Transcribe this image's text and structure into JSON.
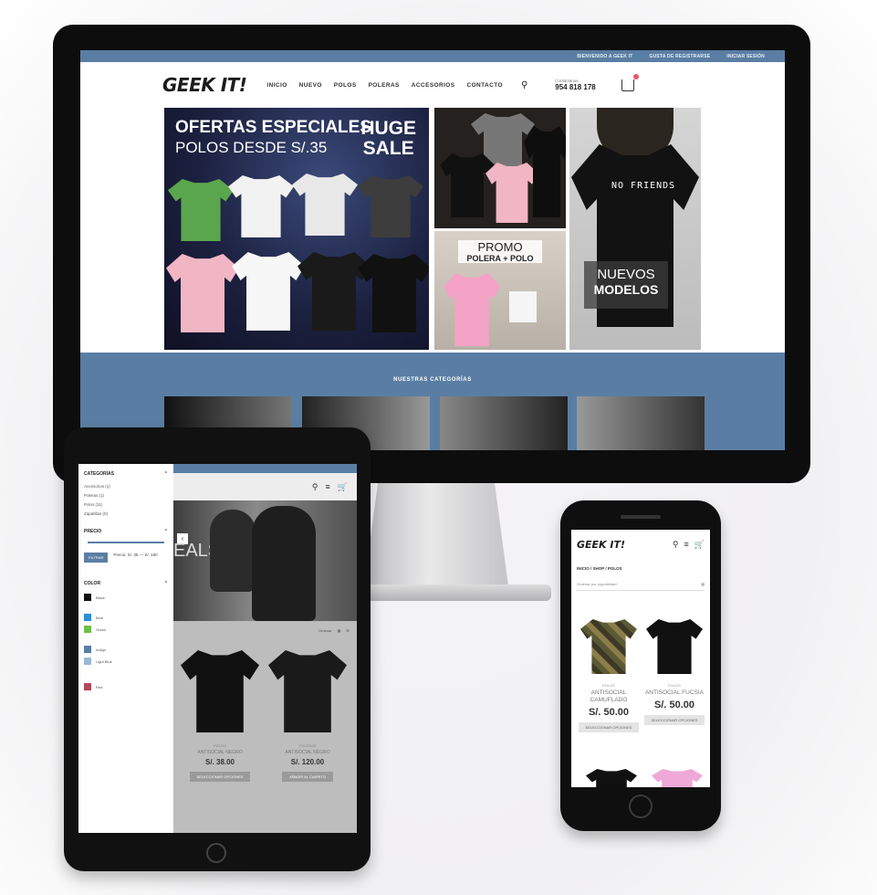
{
  "desktop": {
    "topbar_links": [
      "BIENVENIDO A GEEK IT",
      "GUSTA DE REGISTRARSE",
      "INICIAR SESIÓN"
    ],
    "logo": "GEEK IT!",
    "nav": [
      "INICIO",
      "NUEVO",
      "POLOS",
      "POLERAS",
      "ACCESORIOS",
      "CONTACTO"
    ],
    "phone_label": "Contáctanos",
    "phone_number": "954 818 178",
    "banner_main": {
      "title": "OFERTAS ESPECIALES",
      "subtitle": "POLOS DESDE S/.35",
      "sale_line1": "HUGE",
      "sale_line2": "SALE"
    },
    "banner_b": {
      "line1": "PROMO",
      "line2": "POLERA + POLO"
    },
    "banner_c": {
      "shirt_text": "NO FRIENDS",
      "line1": "NUEVOS",
      "line2": "MODELOS"
    },
    "categories_title": "NUESTRAS CATEGORÍAS"
  },
  "tablet": {
    "sidebar": {
      "categories_heading": "CATEGORÍAS",
      "categories": [
        "Accesorios (1)",
        "Poleras (1)",
        "Polos (11)",
        "Zapatillas (0)"
      ],
      "price_heading": "PRECIO",
      "filter_button": "FILTRAR",
      "price_range": "Precio: S/. 35 — S/. 150",
      "color_heading": "COLOR",
      "colors": [
        {
          "name": "Black",
          "hex": "#111111"
        },
        {
          "name": "Blue",
          "hex": "#2a8fd6"
        },
        {
          "name": "Green",
          "hex": "#6cc04a"
        },
        {
          "name": "Indigo",
          "hex": "#5a7ea3"
        },
        {
          "name": "Light Blue",
          "hex": "#9ab7d3"
        },
        {
          "name": "Red",
          "hex": "#b04a5a"
        }
      ]
    },
    "hero_text": "EALS",
    "sort_label": "Ordenar",
    "products": [
      {
        "category": "POLOS",
        "name": "ANTISOCIAL NEGRO",
        "price": "S/. 38.00",
        "button": "SELECCIONAR OPCIONES"
      },
      {
        "category": "POLERAS",
        "name": "ANTISOCIAL NEGRO",
        "price": "S/. 120.00",
        "button": "AÑADIR AL CARRITO"
      }
    ]
  },
  "phone": {
    "logo": "GEEK IT!",
    "breadcrumb": "INICIO / SHOP / POLOS",
    "sort_placeholder": "Ordenar por popularidad",
    "products": [
      {
        "category": "POLOS",
        "name": "ANTISOCIAL CAMUFLADO",
        "price": "S/. 50.00",
        "button": "SELECCIONAR OPCIONES"
      },
      {
        "category": "POLOS",
        "name": "ANTISOCIAL FUCSIA",
        "price": "S/. 50.00",
        "button": "SELECCIONAR OPCIONES"
      }
    ]
  }
}
